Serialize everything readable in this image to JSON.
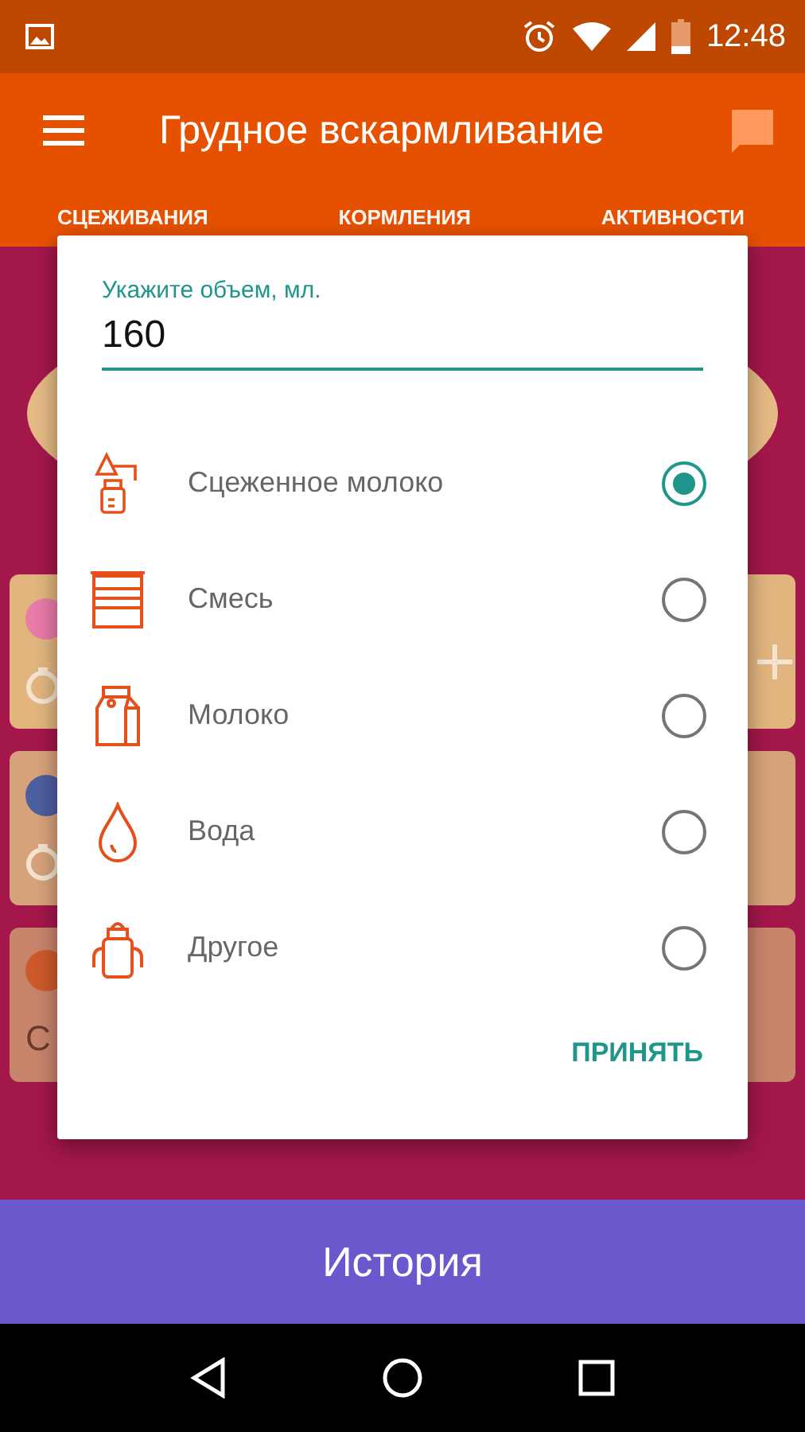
{
  "status_bar": {
    "time": "12:48"
  },
  "app_bar": {
    "title": "Грудное вскармливание"
  },
  "tabs": [
    {
      "label": "СЦЕЖИВАНИЯ",
      "selected": false
    },
    {
      "label": "КОРМЛЕНИЯ",
      "selected": false
    },
    {
      "label": "АКТИВНОСТИ",
      "selected": false
    }
  ],
  "background_cards": [
    {
      "kind": "drop"
    },
    {
      "kind": "rings"
    },
    {
      "kind": "baby",
      "text": "С"
    }
  ],
  "dialog": {
    "label": "Укажите объем, мл.",
    "value": "160",
    "options": [
      {
        "kind": "pump",
        "label": "Сцеженное молоко",
        "selected": true
      },
      {
        "kind": "formula",
        "label": "Смесь",
        "selected": false
      },
      {
        "kind": "carton",
        "label": "Молоко",
        "selected": false
      },
      {
        "kind": "drop",
        "label": "Вода",
        "selected": false
      },
      {
        "kind": "bottle",
        "label": "Другое",
        "selected": false
      }
    ],
    "button": "ПРИНЯТЬ"
  },
  "bottom_button": "История"
}
